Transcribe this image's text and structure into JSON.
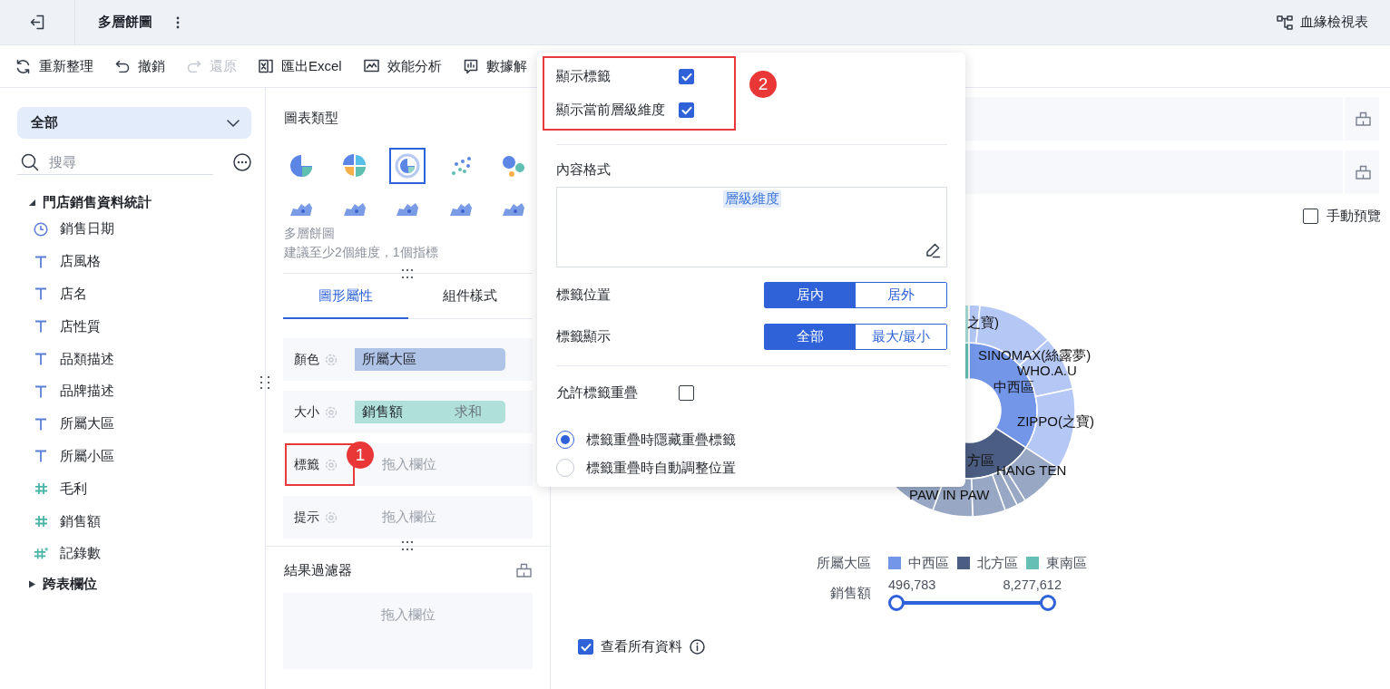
{
  "header": {
    "title": "多層餅圖",
    "lineage": "血緣檢視表"
  },
  "toolbar": [
    {
      "label": "重新整理",
      "kind": "refresh",
      "disabled": false
    },
    {
      "label": "撤銷",
      "kind": "undo",
      "disabled": false
    },
    {
      "label": "還原",
      "kind": "redo",
      "disabled": true
    },
    {
      "label": "匯出Excel",
      "kind": "excel",
      "disabled": false
    },
    {
      "label": "效能分析",
      "kind": "perf",
      "disabled": false
    },
    {
      "label": "數據解",
      "kind": "explain",
      "disabled": false
    }
  ],
  "sidebar": {
    "dataset": "全部",
    "search": {
      "placeholder": "搜尋"
    },
    "tree": [
      {
        "label": "門店銷售資料統計",
        "expanded": true,
        "children": [
          {
            "label": "銷售日期",
            "kind": "date"
          },
          {
            "label": "店風格",
            "kind": "text"
          },
          {
            "label": "店名",
            "kind": "text"
          },
          {
            "label": "店性質",
            "kind": "text"
          },
          {
            "label": "品類描述",
            "kind": "text"
          },
          {
            "label": "品牌描述",
            "kind": "text"
          },
          {
            "label": "所屬大區",
            "kind": "text"
          },
          {
            "label": "所屬小區",
            "kind": "text"
          },
          {
            "label": "毛利",
            "kind": "number"
          },
          {
            "label": "銷售額",
            "kind": "number"
          },
          {
            "label": "記錄數",
            "kind": "count"
          }
        ]
      },
      {
        "label": "跨表欄位",
        "expanded": false
      }
    ]
  },
  "config": {
    "title": "圖表類型",
    "chart_types": [
      {
        "kind": "pie",
        "selected": false
      },
      {
        "kind": "rose",
        "selected": false
      },
      {
        "kind": "multipie",
        "selected": true
      },
      {
        "kind": "scatter",
        "selected": false
      },
      {
        "kind": "bubble",
        "selected": false
      },
      {
        "kind": "map",
        "selected": false
      },
      {
        "kind": "map",
        "selected": false
      },
      {
        "kind": "map",
        "selected": false
      },
      {
        "kind": "map",
        "selected": false
      },
      {
        "kind": "map",
        "selected": false
      }
    ],
    "chart_name": "多層餅圖",
    "hint": "建議至少2個維度，1個指標",
    "tabs": [
      {
        "label": "圖形屬性",
        "selected": true
      },
      {
        "label": "組件樣式",
        "selected": false
      }
    ],
    "slots": [
      {
        "label": "顏色",
        "kind": "dimension",
        "field": "所屬大區",
        "highlighted": false
      },
      {
        "label": "大小",
        "kind": "measure",
        "field": "銷售額",
        "aggregate": "求和",
        "highlighted": false
      },
      {
        "label": "標籤",
        "kind": "empty",
        "hint": "拖入欄位",
        "highlighted": true,
        "callout": "1"
      },
      {
        "label": "提示",
        "kind": "empty",
        "hint": "拖入欄位",
        "highlighted": false
      }
    ],
    "filter": {
      "title": "結果過濾器",
      "hint": "拖入欄位"
    }
  },
  "popover": {
    "highlighted": true,
    "callout": "2",
    "checks": [
      {
        "label": "顯示標籤",
        "checked": true
      },
      {
        "label": "顯示當前層級維度",
        "checked": true
      }
    ],
    "content_format": {
      "label": "內容格式",
      "token": "層級維度"
    },
    "segments": [
      {
        "label": "標籤位置",
        "options": [
          {
            "label": "居內",
            "selected": true
          },
          {
            "label": "居外",
            "selected": false
          }
        ]
      },
      {
        "label": "標籤顯示",
        "options": [
          {
            "label": "全部",
            "selected": true
          },
          {
            "label": "最大/最小",
            "selected": false
          }
        ]
      }
    ],
    "allow_overlap": {
      "label": "允許標籤重疊",
      "checked": false
    },
    "overlap_modes": [
      {
        "label": "標籤重疊時隱藏重疊標籤",
        "selected": true
      },
      {
        "label": "標籤重疊時自動調整位置",
        "selected": false
      }
    ]
  },
  "preview": {
    "label": "手動預覽",
    "checked": false
  },
  "chart": {
    "labels": [
      "之寶)",
      "SINOMAX(絲露夢)",
      "WHO.A.U",
      "中西區",
      "ZIPPO(之寶)",
      "方區",
      "HANG TEN",
      "PAW IN PAW"
    ],
    "legend": {
      "title": "所屬大區",
      "items": [
        {
          "label": "中西區",
          "color": "#7396e8"
        },
        {
          "label": "北方區",
          "color": "#4b5d82"
        },
        {
          "label": "東南區",
          "color": "#66bfb4"
        }
      ]
    },
    "range": {
      "label": "銷售額",
      "min": "496,783",
      "max": "8,277,612",
      "level": 1
    }
  },
  "view_all": {
    "label": "查看所有資料",
    "checked": true
  }
}
